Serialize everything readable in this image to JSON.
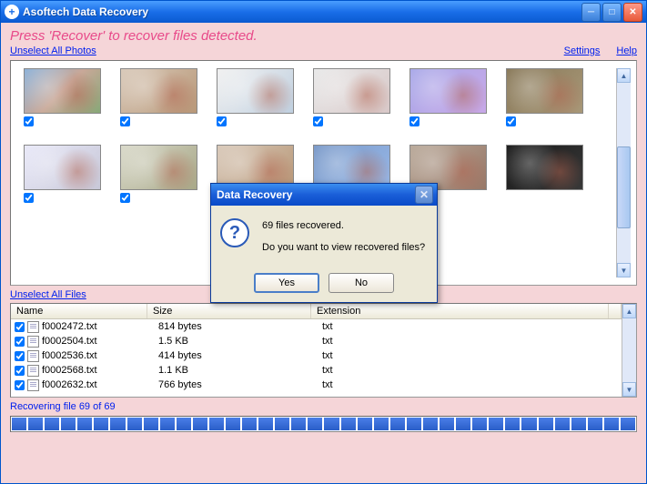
{
  "titlebar": {
    "app_name": "Asoftech Data Recovery"
  },
  "instruction": "Press 'Recover' to recover files detected.",
  "links": {
    "unselect_photos": "Unselect All Photos",
    "unselect_files": "Unselect All Files",
    "settings": "Settings",
    "help": "Help"
  },
  "file_table": {
    "headers": {
      "name": "Name",
      "size": "Size",
      "ext": "Extension"
    },
    "rows": [
      {
        "name": "f0002472.txt",
        "size": "814 bytes",
        "ext": "txt"
      },
      {
        "name": "f0002504.txt",
        "size": "1.5 KB",
        "ext": "txt"
      },
      {
        "name": "f0002536.txt",
        "size": "414 bytes",
        "ext": "txt"
      },
      {
        "name": "f0002568.txt",
        "size": "1.1 KB",
        "ext": "txt"
      },
      {
        "name": "f0002632.txt",
        "size": "766 bytes",
        "ext": "txt"
      }
    ]
  },
  "status": "Recovering file 69 of 69",
  "dialog": {
    "title": "Data Recovery",
    "line1": "69 files recovered.",
    "line2": "Do you want to view recovered files?",
    "yes": "Yes",
    "no": "No"
  }
}
